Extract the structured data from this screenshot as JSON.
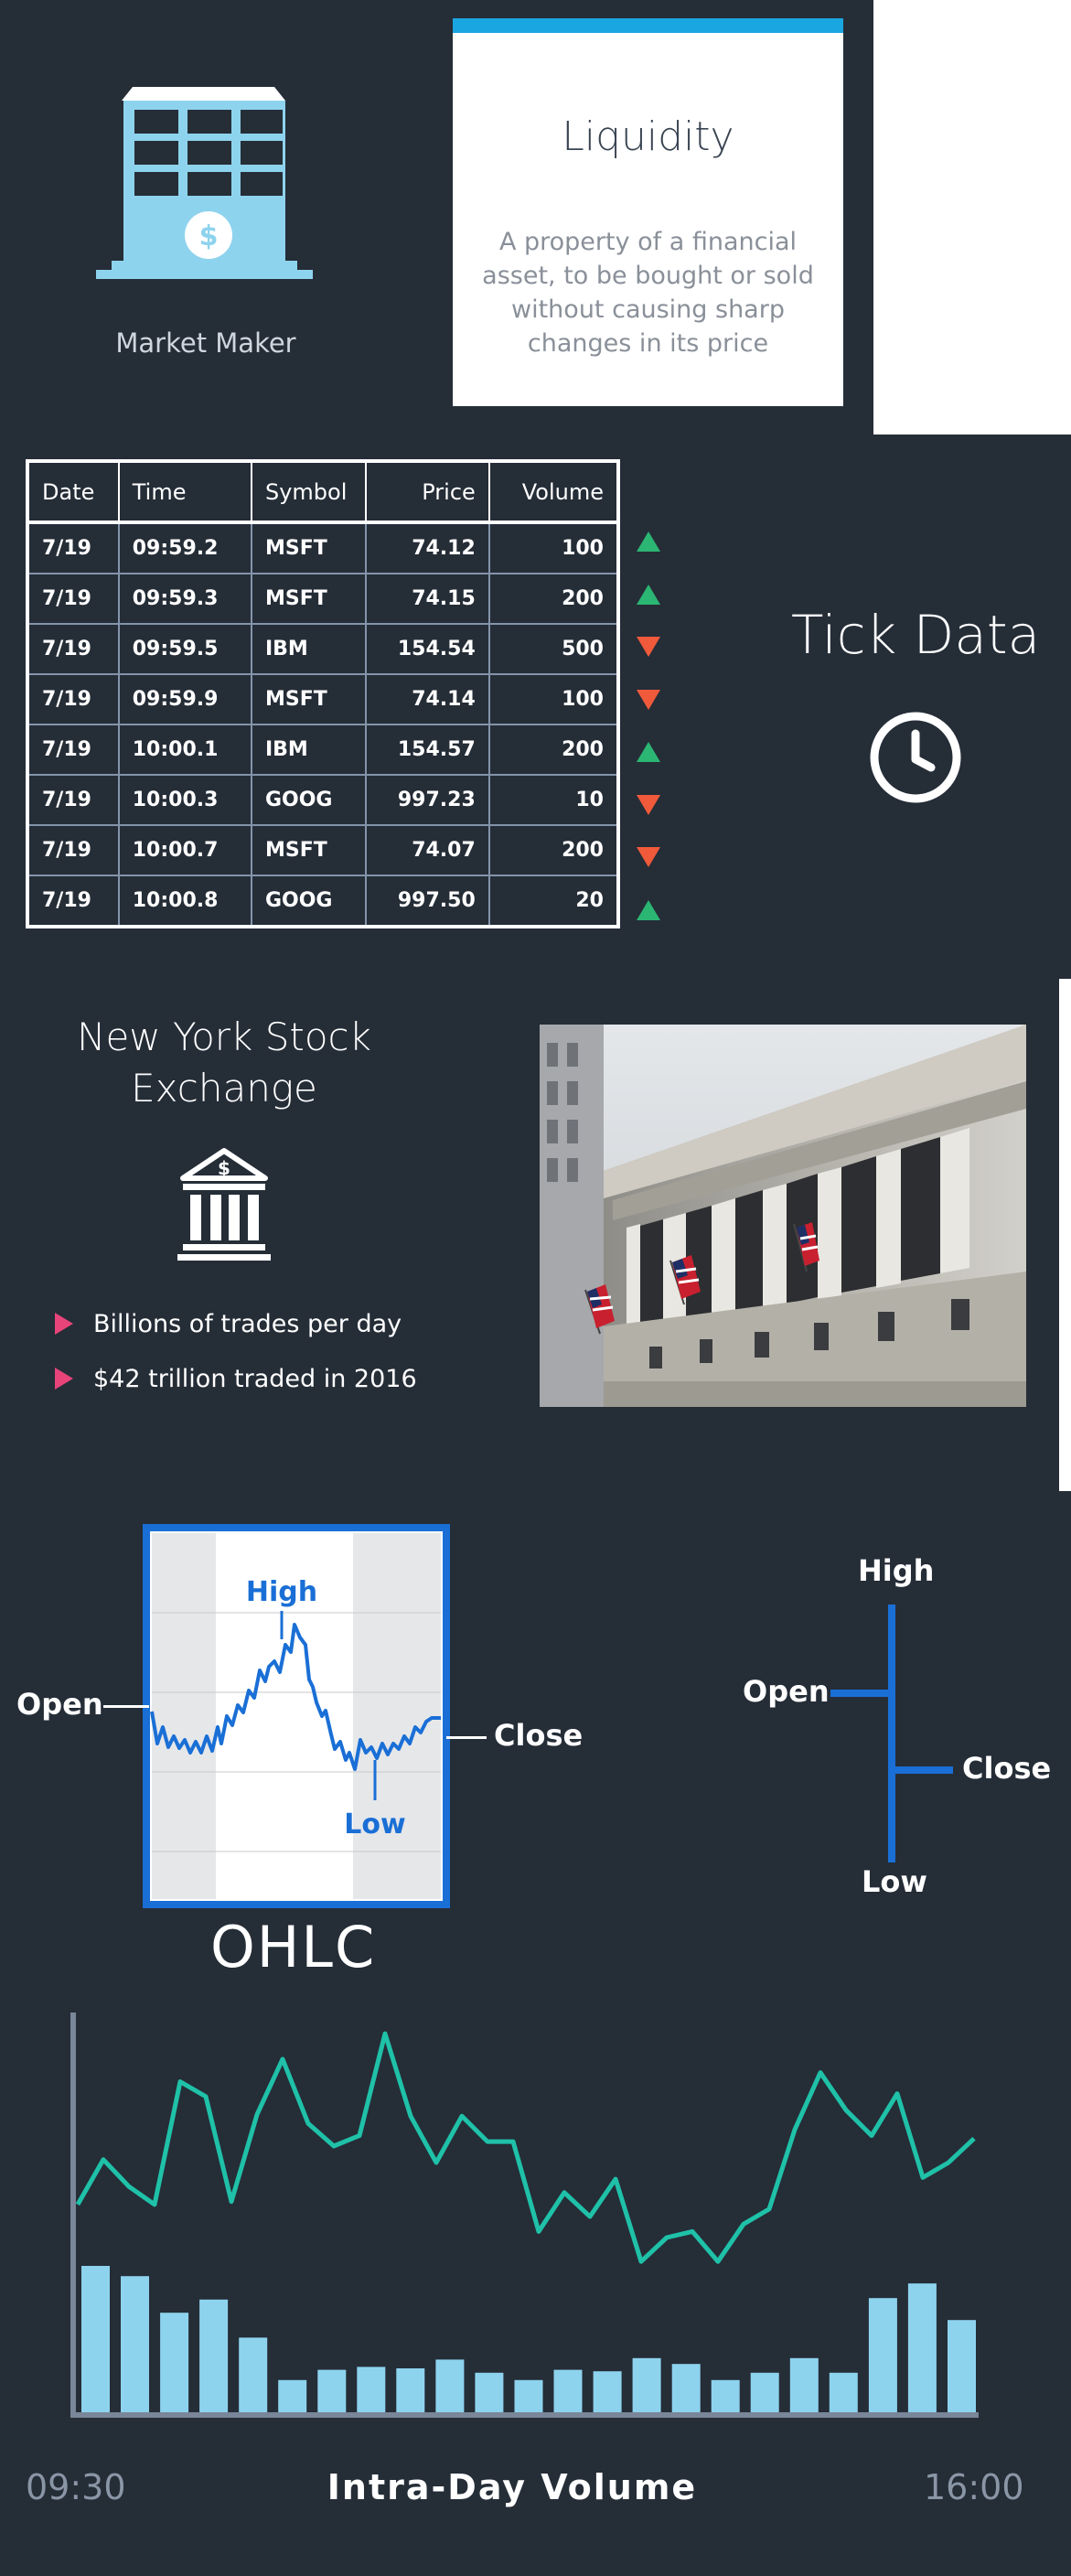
{
  "market_maker": {
    "label": "Market Maker",
    "icon": "building-dollar-icon"
  },
  "liquidity": {
    "title": "Liquidity",
    "description": "A property of a financial asset, to be bought or sold without causing sharp changes in its price"
  },
  "tick_data": {
    "title": "Tick Data",
    "icon": "clock-icon",
    "columns": [
      "Date",
      "Time",
      "Symbol",
      "Price",
      "Volume"
    ],
    "rows": [
      {
        "date": "7/19",
        "time": "09:59.2",
        "symbol": "MSFT",
        "price": "74.12",
        "volume": "100",
        "direction": "up"
      },
      {
        "date": "7/19",
        "time": "09:59.3",
        "symbol": "MSFT",
        "price": "74.15",
        "volume": "200",
        "direction": "up"
      },
      {
        "date": "7/19",
        "time": "09:59.5",
        "symbol": "IBM",
        "price": "154.54",
        "volume": "500",
        "direction": "down"
      },
      {
        "date": "7/19",
        "time": "09:59.9",
        "symbol": "MSFT",
        "price": "74.14",
        "volume": "100",
        "direction": "down"
      },
      {
        "date": "7/19",
        "time": "10:00.1",
        "symbol": "IBM",
        "price": "154.57",
        "volume": "200",
        "direction": "up"
      },
      {
        "date": "7/19",
        "time": "10:00.3",
        "symbol": "GOOG",
        "price": "997.23",
        "volume": "10",
        "direction": "down"
      },
      {
        "date": "7/19",
        "time": "10:00.7",
        "symbol": "MSFT",
        "price": "74.07",
        "volume": "200",
        "direction": "down"
      },
      {
        "date": "7/19",
        "time": "10:00.8",
        "symbol": "GOOG",
        "price": "997.50",
        "volume": "20",
        "direction": "up"
      }
    ],
    "up_color": "#2bb673",
    "down_color": "#f05a3a"
  },
  "nyse": {
    "title_line1": "New York Stock",
    "title_line2": "Exchange",
    "icon": "bank-dollar-icon",
    "bullets": [
      "Billions of trades per day",
      "$42 trillion traded in 2016"
    ],
    "bullet_color": "#e8447a",
    "photo": "nyse-building-photo"
  },
  "ohlc": {
    "title": "OHLC",
    "open": "Open",
    "high": "High",
    "low": "Low",
    "close": "Close",
    "line_color": "#1a6fd6"
  },
  "intraday": {
    "title": "Intra-Day Volume",
    "start": "09:30",
    "end": "16:00",
    "line_color": "#1fc1a8",
    "bar_color": "#8ed3ee"
  },
  "chart_data": {
    "type": "bar",
    "title": "",
    "xlabel": "Intra-Day Volume",
    "ylabel": "",
    "x_range": [
      "09:30",
      "16:00"
    ],
    "series": [
      {
        "values": [
          100,
          93,
          68,
          77,
          51,
          22,
          29,
          31,
          30,
          36,
          27,
          22,
          29,
          28,
          37,
          33,
          22,
          27,
          37,
          27,
          78,
          88,
          63
        ]
      },
      {
        "values": [
          118,
          148,
          130,
          118,
          200,
          190,
          120,
          178,
          215,
          172,
          157,
          164,
          232,
          177,
          146,
          177,
          160,
          160,
          100,
          126,
          110,
          135,
          80,
          96,
          100,
          80,
          105,
          115,
          168,
          206,
          181,
          164,
          192,
          136,
          146,
          162
        ]
      }
    ]
  }
}
